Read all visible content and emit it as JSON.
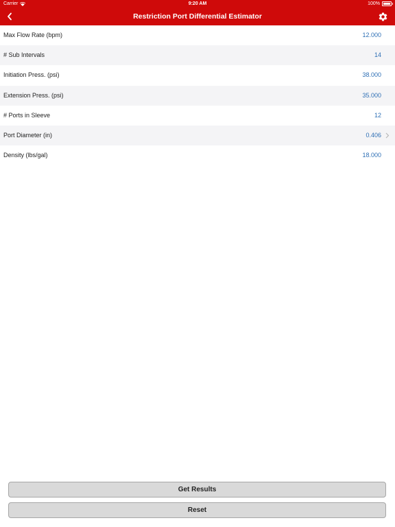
{
  "status_bar": {
    "carrier": "Carrier",
    "time": "9:20 AM",
    "battery": "100%"
  },
  "nav": {
    "title": "Restriction Port Differential Estimator",
    "back_icon": "chevron-left-icon",
    "settings_icon": "gear-icon"
  },
  "colors": {
    "accent": "#cf0a0a",
    "value_text": "#2e6fb5",
    "button_bg": "#d9d9d9"
  },
  "rows": [
    {
      "label": "Max Flow Rate (bpm)",
      "value": "12.000"
    },
    {
      "label": "# Sub Intervals",
      "value": "14"
    },
    {
      "label": "Initiation Press. (psi)",
      "value": "38.000"
    },
    {
      "label": "Extension Press. (psi)",
      "value": "35.000"
    },
    {
      "label": "# Ports in Sleeve",
      "value": "12"
    },
    {
      "label": "Port Diameter (in)",
      "value": "0.406"
    },
    {
      "label": "Density (lbs/gal)",
      "value": "18.000"
    }
  ],
  "buttons": {
    "get_results": "Get Results",
    "reset": "Reset"
  }
}
